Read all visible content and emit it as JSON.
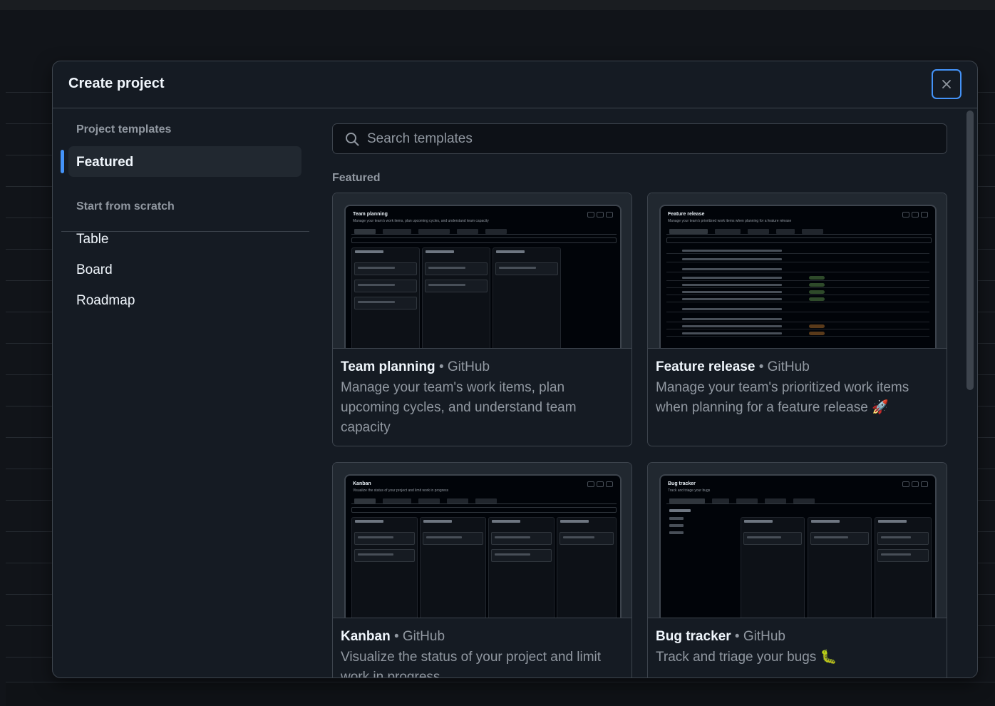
{
  "dialog": {
    "title": "Create project",
    "close_label": "Close"
  },
  "sidebar": {
    "templates_heading": "Project templates",
    "featured_label": "Featured",
    "scratch_heading": "Start from scratch",
    "scratch_items": [
      "Table",
      "Board",
      "Roadmap"
    ]
  },
  "search": {
    "placeholder": "Search templates"
  },
  "main": {
    "section_label": "Featured",
    "cards": [
      {
        "name": "Team planning",
        "owner": "GitHub",
        "description": "Manage your team's work items, plan upcoming cycles, and understand team capacity",
        "preview_title": "Team planning",
        "preview_sub": "Manage your team's work items, plan upcoming cycles, and understand team capacity"
      },
      {
        "name": "Feature release",
        "owner": "GitHub",
        "description": "Manage your team's prioritized work items when planning for a feature release 🚀",
        "preview_title": "Feature release",
        "preview_sub": "Manage your team's prioritized work items when planning for a feature release"
      },
      {
        "name": "Kanban",
        "owner": "GitHub",
        "description": "Visualize the status of your project and limit work in progress",
        "preview_title": "Kanban",
        "preview_sub": "Visualize the status of your project and limit work in progress"
      },
      {
        "name": "Bug tracker",
        "owner": "GitHub",
        "description": "Track and triage your bugs 🐛",
        "preview_title": "Bug tracker",
        "preview_sub": "Track and triage your bugs"
      }
    ],
    "separator": "•"
  }
}
